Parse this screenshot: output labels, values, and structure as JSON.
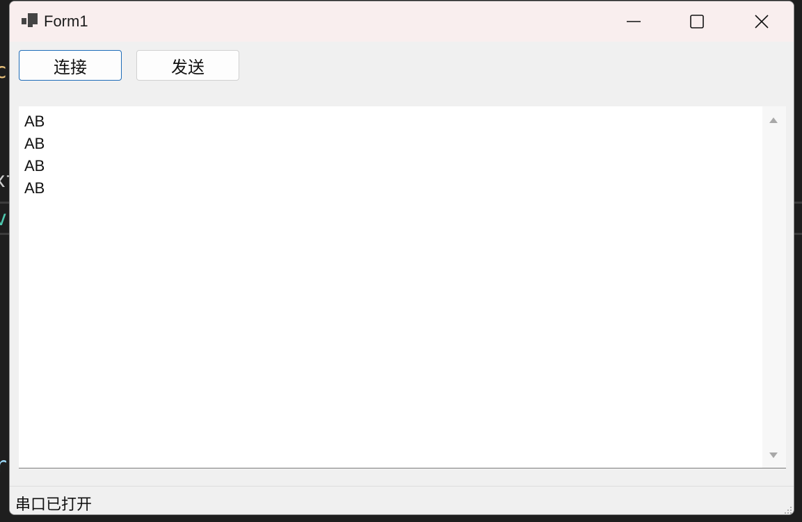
{
  "window": {
    "title": "Form1",
    "controls": {
      "minimize_icon": "minimize-icon",
      "maximize_icon": "maximize-icon",
      "close_icon": "close-icon"
    }
  },
  "toolbar": {
    "connect_label": "连接",
    "send_label": "发送"
  },
  "output": {
    "lines": [
      "AB",
      "AB",
      "AB",
      "AB"
    ]
  },
  "status": {
    "text": "串口已打开"
  },
  "colors": {
    "titlebar_bg": "#f9eeee",
    "window_bg": "#f0f0f0",
    "focus_border": "#1c6bb8"
  }
}
